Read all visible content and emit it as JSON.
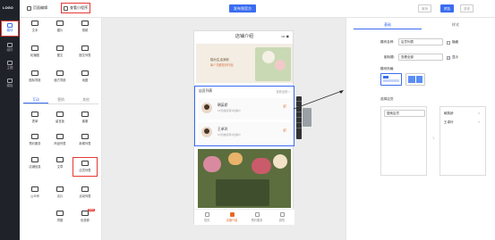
{
  "nav": {
    "logo": "LOGO",
    "items": [
      {
        "label": "模块"
      },
      {
        "label": "组件"
      },
      {
        "label": "主题"
      },
      {
        "label": "模板"
      }
    ]
  },
  "topbar": {
    "page_manage": "页面编辑",
    "mini_program": "查看小程序",
    "publish": "发布到官方",
    "undo": "撤销",
    "preview": "预览",
    "redo": "重做"
  },
  "components": {
    "basic": [
      {
        "label": "文本"
      },
      {
        "label": "图片"
      },
      {
        "label": "视频"
      },
      {
        "label": "轮播图"
      },
      {
        "label": "图文"
      },
      {
        "label": "图文列表"
      },
      {
        "label": "图标导航"
      },
      {
        "label": "魔方导航"
      },
      {
        "label": "地图"
      }
    ],
    "tabs": [
      {
        "label": "互动",
        "active": true
      },
      {
        "label": "营销",
        "active": false
      },
      {
        "label": "其他",
        "active": false
      }
    ],
    "interactive": [
      {
        "label": "表单"
      },
      {
        "label": "留言板"
      },
      {
        "label": "客服"
      },
      {
        "label": "预约服务"
      },
      {
        "label": "商品列表"
      },
      {
        "label": "新闻列表"
      },
      {
        "label": "店铺信息"
      },
      {
        "label": "文章"
      },
      {
        "label": "店员列表",
        "selected": true
      },
      {
        "label": "公众号"
      },
      {
        "label": "名片"
      },
      {
        "label": "活动列表"
      },
      {
        "label": "拼团"
      },
      {
        "label": "优惠券",
        "badge": "NEW"
      }
    ]
  },
  "phone": {
    "title": "店铺介绍",
    "banner_title": "描为生活添彩",
    "banner_sub": "每个花都是诗作品",
    "staff_title": "店员列表",
    "staff_more": "查看全部 >",
    "staff": [
      {
        "name": "朝英娇",
        "desc": "15天前接待1位客户"
      },
      {
        "name": "王卓玲",
        "desc": "15天前接待1位客户"
      }
    ],
    "tabbar": [
      {
        "label": "首页",
        "active": false
      },
      {
        "label": "店铺介绍",
        "active": true
      },
      {
        "label": "预约服务",
        "active": false
      },
      {
        "label": "我的",
        "active": false
      }
    ]
  },
  "right_panel": {
    "tabs": [
      {
        "label": "基础",
        "active": true
      },
      {
        "label": "样式",
        "active": false
      }
    ],
    "module_name_label": "模块名称:",
    "module_name_value": "店员列表",
    "module_name_hide": "隐藏",
    "subtitle_label": "副标题:",
    "subtitle_value": "查看全部",
    "subtitle_show": "显示",
    "style_label": "模块风格:",
    "select_label": "选择店员:",
    "search_placeholder": "搜索店员",
    "selected_staff": [
      {
        "name": "朝英娇"
      },
      {
        "name": "王卓玲"
      }
    ]
  },
  "colors": {
    "accent": "#3a6cf0",
    "highlight": "#e53935",
    "orange": "#e76a24"
  }
}
